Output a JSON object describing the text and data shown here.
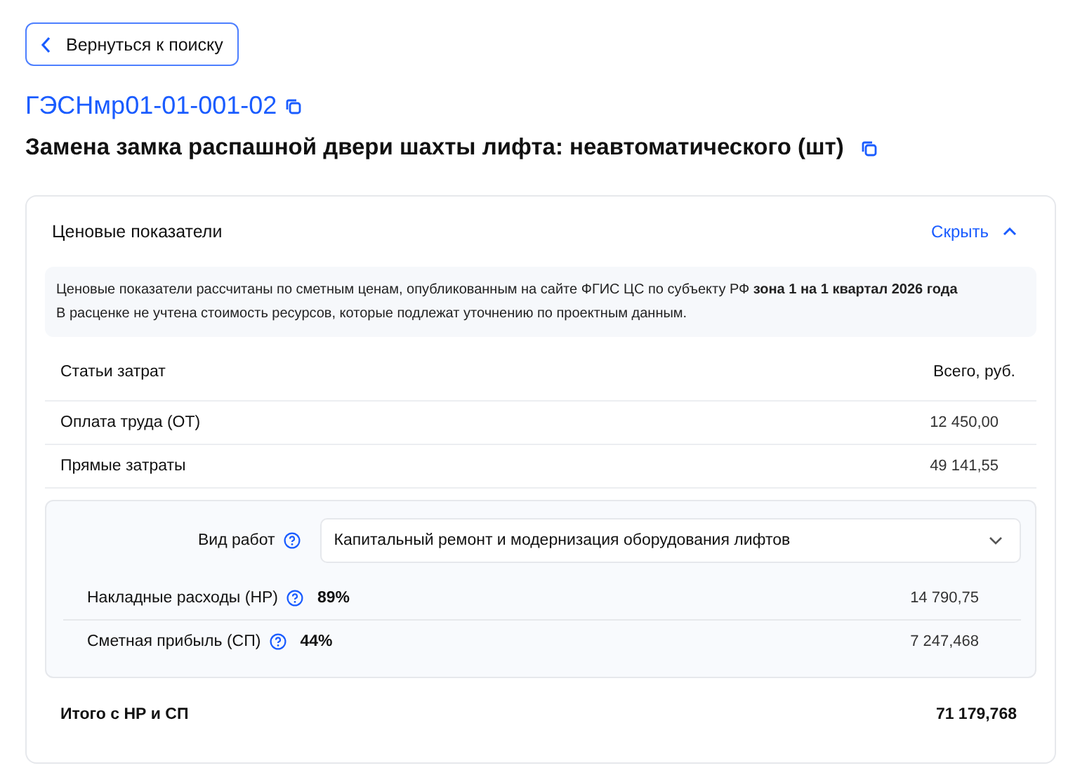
{
  "back_button": {
    "label": "Вернуться к поиску"
  },
  "code": "ГЭСНмр01-01-001-02",
  "title": "Замена замка распашной двери шахты лифта: неавтоматического (шт)",
  "panel": {
    "title": "Ценовые показатели",
    "toggle": {
      "label": "Скрыть",
      "expanded": true
    },
    "notes": [
      "Ценовые показатели рассчитаны по сметным ценам, опубликованным на сайте ФГИС ЦС по субъекту РФ **зона 1 на 1 квартал 2026 года**",
      "В расценке не учтена стоимость ресурсов, которые подлежат уточнению по проектным данным."
    ],
    "table": {
      "columns": [
        "Статьи затрат",
        "Всего, руб."
      ],
      "rows": [
        {
          "label": "Оплата труда (ОТ)",
          "value": "12 450,00"
        },
        {
          "label": "Прямые затраты",
          "value": "49 141,55"
        }
      ]
    },
    "work_type": {
      "label": "Вид работ",
      "value": "Капитальный ремонт и модернизация оборудования лифтов"
    },
    "rates": [
      {
        "label": "Накладные расходы (НР)",
        "percent": "89%",
        "value": "14 790,75"
      },
      {
        "label": "Сметная прибыль (СП)",
        "percent": "44%",
        "value": "7 247,468"
      }
    ],
    "total": {
      "label": "Итого с НР и СП",
      "value": "71 179,768"
    }
  }
}
